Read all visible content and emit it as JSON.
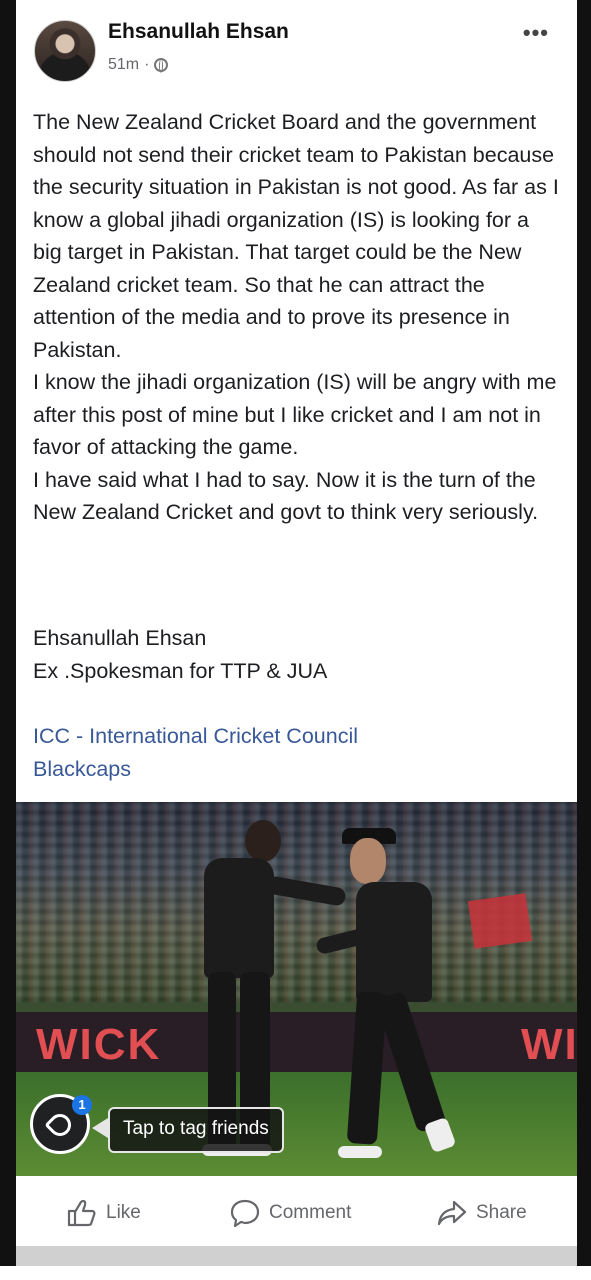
{
  "post": {
    "author": "Ehsanullah Ehsan",
    "time": "51m",
    "more_icon": "more-horizontal-icon",
    "privacy_icon": "globe-icon",
    "body": "The New Zealand Cricket Board and the government should not send their cricket team to Pakistan because the security situation in Pakistan is not good. As far as I know a global jihadi organization (IS) is looking for a big target in Pakistan. That target could be the New Zealand cricket team. So that he can attract the attention of the media and to prove its presence in Pakistan.\nI know the jihadi organization (IS) will be angry with me after this post of mine but I like cricket and I am not in favor of attacking the game.\nI have said what I had to say. Now it is the turn of the New Zealand Cricket and govt to think very seriously.",
    "signature_name": "Ehsanullah Ehsan",
    "signature_title": "Ex .Spokesman for TTP & JUA",
    "tags": [
      "ICC - International Cricket Council",
      "Blackcaps"
    ]
  },
  "photo": {
    "board_text_left": "WICK",
    "board_text_right": "WI",
    "tag_count": "1",
    "tag_prompt": "Tap to tag friends"
  },
  "actions": {
    "like": "Like",
    "comment": "Comment",
    "share": "Share"
  },
  "colors": {
    "link": "#385898",
    "meta": "#65676b",
    "badge": "#1b74e4"
  }
}
